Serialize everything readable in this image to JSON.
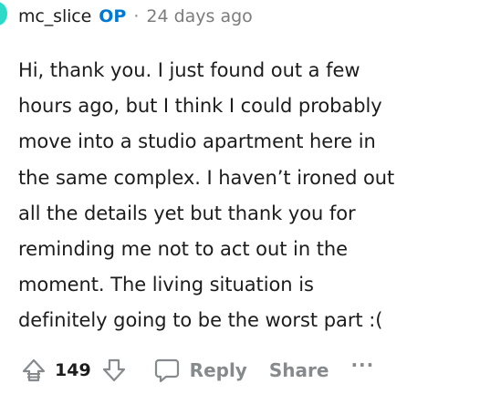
{
  "comment": {
    "author": "mc_slice",
    "op_badge": "OP",
    "separator": "·",
    "time_ago": "24 days ago",
    "body": "Hi, thank you. I just found out a few\nhours ago, but I think I could probably\nmove into a studio apartment here in\nthe same complex. I haven’t ironed out\nall the details yet but thank you for\nreminding me not to act out in the\nmoment. The living situation is\ndefinitely going to be the worst part :("
  },
  "actions": {
    "score": "149",
    "reply_label": "Reply",
    "share_label": "Share",
    "more_label": "···",
    "upvote_icon": "upvote-arrow-icon",
    "downvote_icon": "downvote-arrow-icon",
    "reply_icon": "chat-bubble-icon",
    "icon_color": "#878a8c",
    "op_color": "#0079d3"
  }
}
